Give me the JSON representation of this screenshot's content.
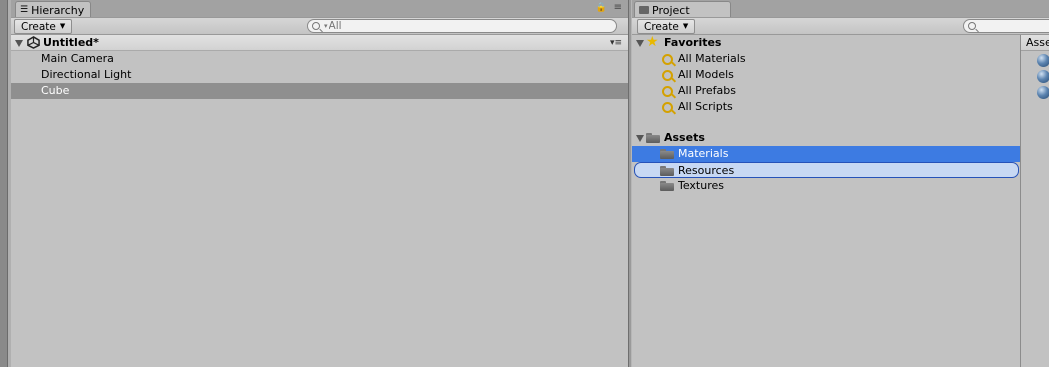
{
  "hierarchy": {
    "tab_label": "Hierarchy",
    "create_label": "Create",
    "search_placeholder": "All",
    "scene_name": "Untitled*",
    "items": [
      {
        "label": "Main Camera"
      },
      {
        "label": "Directional Light"
      },
      {
        "label": "Cube"
      }
    ]
  },
  "project": {
    "tab_label": "Project",
    "create_label": "Create",
    "search_placeholder": "",
    "favorites_label": "Favorites",
    "favorites": [
      {
        "label": "All Materials"
      },
      {
        "label": "All Models"
      },
      {
        "label": "All Prefabs"
      },
      {
        "label": "All Scripts"
      }
    ],
    "assets_label": "Assets",
    "folders": [
      {
        "label": "Materials"
      },
      {
        "label": "Resources"
      },
      {
        "label": "Textures"
      }
    ],
    "asset_pane_header": "Asse"
  },
  "colors": {
    "selection_blue": "#3d7be2",
    "selection_gray": "#8f8f8f",
    "panel_bg": "#c2c2c2",
    "favorite_gold": "#d4a100"
  },
  "icons": {
    "hierarchy_tab": "list-icon",
    "project_tab": "folder-icon",
    "scene": "unity-logo-icon",
    "favorites": "star-icon",
    "favorite_item": "saved-search-icon",
    "folder": "folder-icon",
    "asset": "material-sphere-icon"
  }
}
